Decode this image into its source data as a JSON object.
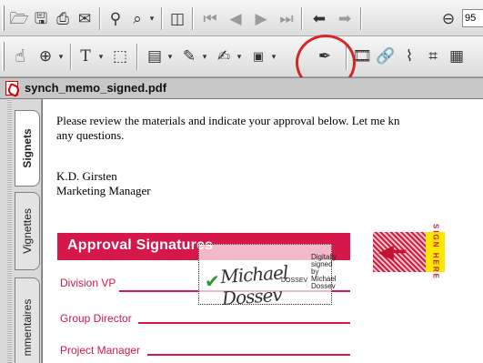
{
  "toolbar_top": {
    "icons": [
      "open-icon",
      "save-icon",
      "print-icon",
      "email-icon",
      "search-icon",
      "find-icon",
      "pages-icon",
      "first-page-icon",
      "previous-page-icon",
      "next-page-icon",
      "last-page-icon",
      "go-back-icon",
      "go-forward-icon",
      "zoom-out-icon"
    ],
    "zoom_value": "95"
  },
  "toolbar_tools": {
    "icons": [
      "hand-tool-icon",
      "zoom-tool-icon",
      "text-select-icon",
      "graphics-select-icon",
      "note-tool-icon",
      "pencil-tool-icon",
      "highlight-tool-icon",
      "stamp-tool-icon",
      "digital-signature-tool-icon",
      "movie-tool-icon",
      "link-tool-icon",
      "article-tool-icon",
      "crop-tool-icon",
      "form-tool-icon"
    ]
  },
  "document": {
    "filename": "synch_memo_signed.pdf",
    "body_line1": "Please review the materials and indicate your approval below. Let me kn",
    "body_line2": "any questions.",
    "sender_name": "K.D. Girsten",
    "sender_title": "Marketing Manager"
  },
  "nav_tabs": [
    {
      "label": "Signets"
    },
    {
      "label": "Vignettes"
    },
    {
      "label": "mmentaires"
    }
  ],
  "approval": {
    "title": "Approval Signatures",
    "roles": [
      "Division VP",
      "Group Director",
      "Project Manager"
    ]
  },
  "signature": {
    "script": "Michael Dossev",
    "small_name": "DOSSEV",
    "digital_lines": [
      "Digitally",
      "signed",
      "by",
      "Michael",
      "Dossev"
    ]
  },
  "sign_here": {
    "text": "SIGN HERE"
  },
  "colors": {
    "accent": "#d5174a",
    "highlight_circle": "#d72626",
    "sticker_yellow": "#ffe600"
  }
}
